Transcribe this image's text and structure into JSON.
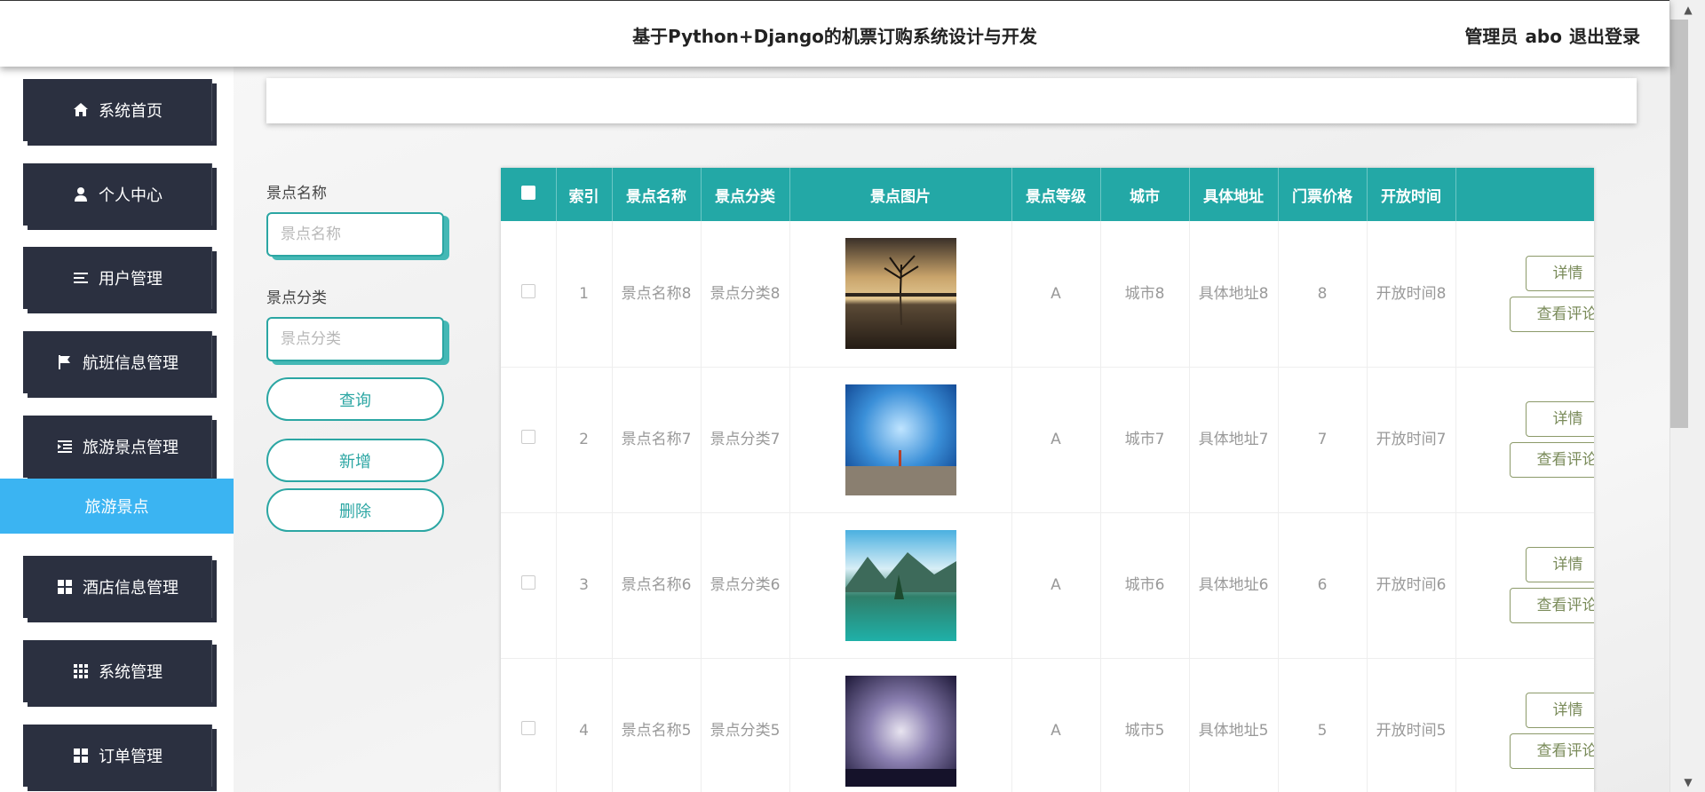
{
  "header": {
    "title": "基于Python+Django的机票订购系统设计与开发",
    "user_role": "管理员",
    "username": "abo",
    "logout_label": "退出登录"
  },
  "sidebar": {
    "items": [
      {
        "label": "系统首页",
        "icon": "home-icon"
      },
      {
        "label": "个人中心",
        "icon": "user-icon"
      },
      {
        "label": "用户管理",
        "icon": "list-icon"
      },
      {
        "label": "航班信息管理",
        "icon": "flag-icon"
      },
      {
        "label": "旅游景点管理",
        "icon": "indent-icon"
      },
      {
        "label": "酒店信息管理",
        "icon": "grid-icon"
      },
      {
        "label": "系统管理",
        "icon": "apps-icon"
      },
      {
        "label": "订单管理",
        "icon": "grid-icon"
      }
    ],
    "active_sub": "旅游景点"
  },
  "search": {
    "name_label": "景点名称",
    "name_placeholder": "景点名称",
    "category_label": "景点分类",
    "category_placeholder": "景点分类",
    "query_label": "查询",
    "add_label": "新增",
    "delete_label": "删除"
  },
  "table": {
    "headers": [
      "索引",
      "景点名称",
      "景点分类",
      "景点图片",
      "景点等级",
      "城市",
      "具体地址",
      "门票价格",
      "开放时间"
    ],
    "rows": [
      {
        "index": "1",
        "name": "景点名称8",
        "category": "景点分类8",
        "level": "A",
        "city": "城市8",
        "address": "具体地址8",
        "price": "8",
        "open": "开放时间8"
      },
      {
        "index": "2",
        "name": "景点名称7",
        "category": "景点分类7",
        "level": "A",
        "city": "城市7",
        "address": "具体地址7",
        "price": "7",
        "open": "开放时间7"
      },
      {
        "index": "3",
        "name": "景点名称6",
        "category": "景点分类6",
        "level": "A",
        "city": "城市6",
        "address": "具体地址6",
        "price": "6",
        "open": "开放时间6"
      },
      {
        "index": "4",
        "name": "景点名称5",
        "category": "景点分类5",
        "level": "A",
        "city": "城市5",
        "address": "具体地址5",
        "price": "5",
        "open": "开放时间5"
      }
    ],
    "detail_label": "详情",
    "review_label": "查看评论"
  },
  "colors": {
    "teal": "#23a8a6",
    "sidebar_dark": "#2b3040",
    "active_blue": "#3bb4f2"
  }
}
